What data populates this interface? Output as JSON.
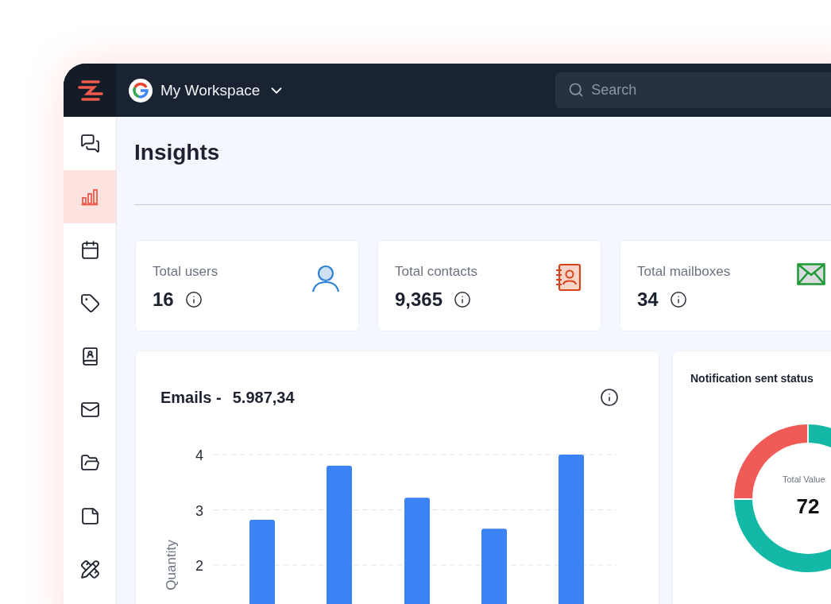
{
  "workspace": {
    "name": "My Workspace"
  },
  "search": {
    "placeholder": "Search"
  },
  "sidebar": {
    "items": [
      {
        "kind": "chat",
        "selected": false
      },
      {
        "kind": "chart",
        "selected": true
      },
      {
        "kind": "calendar",
        "selected": false
      },
      {
        "kind": "tag",
        "selected": false
      },
      {
        "kind": "contacts",
        "selected": false
      },
      {
        "kind": "mail",
        "selected": false
      },
      {
        "kind": "folder",
        "selected": false
      },
      {
        "kind": "note",
        "selected": false
      },
      {
        "kind": "tools",
        "selected": false
      }
    ]
  },
  "page": {
    "title": "Insights"
  },
  "stats": [
    {
      "kind": "users",
      "label": "Total users",
      "value": "16"
    },
    {
      "kind": "contacts",
      "label": "Total contacts",
      "value": "9,365"
    },
    {
      "kind": "mailboxes",
      "label": "Total mailboxes",
      "value": "34"
    }
  ],
  "emails_chart": {
    "title": "Emails -",
    "total": "5.987,34",
    "chart_data": {
      "type": "bar",
      "ylabel": "Quantity",
      "ylim": [
        0,
        4
      ],
      "yticks": [
        2,
        3,
        4
      ],
      "grid": true,
      "series": [
        {
          "color": "#3b82f6",
          "values": [
            2.82,
            3.8,
            3.22,
            2.66,
            4.0
          ]
        }
      ]
    }
  },
  "notification_card": {
    "title": "Notification sent status",
    "center_label": "Total Value",
    "center_value": "72"
  }
}
